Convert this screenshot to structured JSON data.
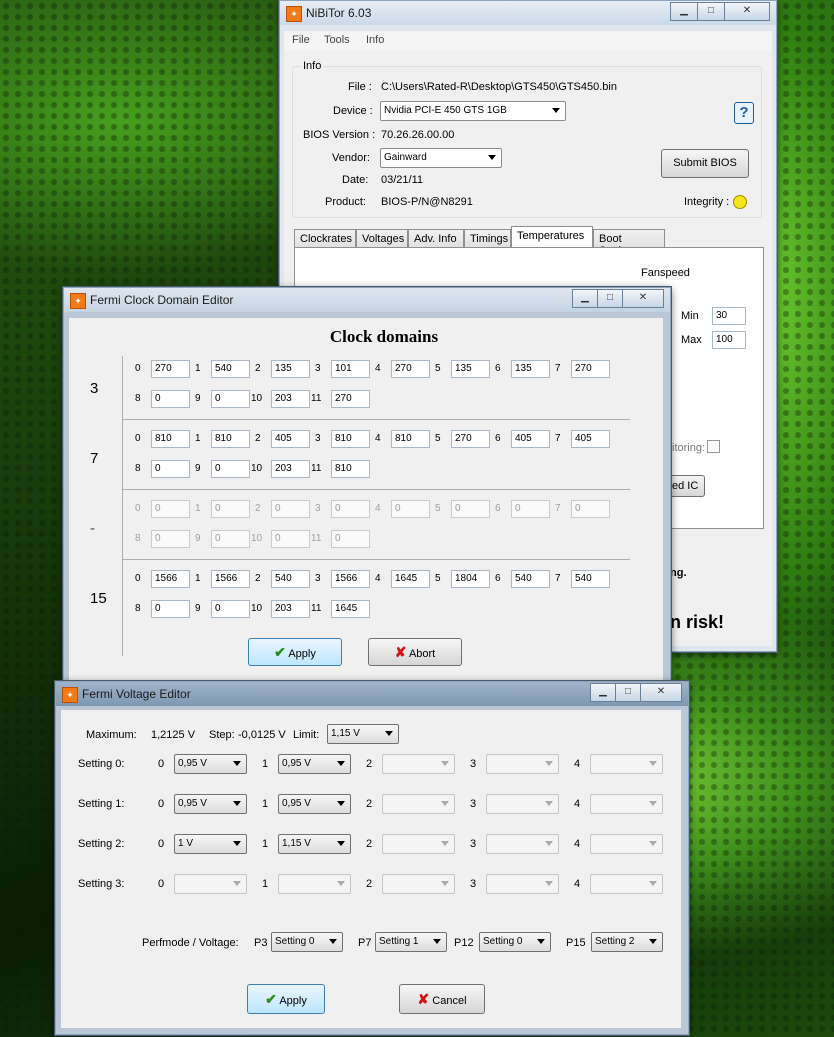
{
  "nibitor": {
    "title": "NiBiTor 6.03",
    "menu": [
      "File",
      "Tools",
      "Info"
    ],
    "info_group": "Info",
    "file_label": "File :",
    "file_value": "C:\\Users\\Rated-R\\Desktop\\GTS450\\GTS450.bin",
    "device_label": "Device :",
    "device_value": "Nvidia PCI-E 450 GTS 1GB",
    "bios_label": "BIOS Version :",
    "bios_value": "70.26.26.00.00",
    "vendor_label": "Vendor:",
    "vendor_value": "Gainward",
    "date_label": "Date:",
    "date_value": "03/21/11",
    "product_label": "Product:",
    "product_value": "BIOS-P/N@N8291",
    "help_symbol": "?",
    "submit_label": "Submit BIOS",
    "integrity_label": "Integrity :",
    "integrity_color": "#f5e51a",
    "tabs": [
      "Clockrates",
      "Voltages",
      "Adv. Info",
      "Timings",
      "Temperatures",
      "Boot Settings"
    ],
    "fanspeed_label": "Fanspeed",
    "min_label": "Min",
    "min_value": "30",
    "max_label": "Max",
    "max_value": "100",
    "monitoring_fragment": "itoring:",
    "ic_fragment": "ed IC",
    "warn1": "ng.",
    "warn2": "n risk!"
  },
  "clock_editor": {
    "title": "Fermi Clock Domain Editor",
    "heading": "Clock domains",
    "groups": [
      {
        "label": "3",
        "disabled": false,
        "values": [
          "270",
          "540",
          "135",
          "101",
          "270",
          "135",
          "135",
          "270",
          "0",
          "0",
          "203",
          "270"
        ]
      },
      {
        "label": "7",
        "disabled": false,
        "values": [
          "810",
          "810",
          "405",
          "810",
          "810",
          "270",
          "405",
          "405",
          "0",
          "0",
          "203",
          "810"
        ]
      },
      {
        "label": "-",
        "disabled": true,
        "values": [
          "0",
          "0",
          "0",
          "0",
          "0",
          "0",
          "0",
          "0",
          "0",
          "0",
          "0",
          "0"
        ]
      },
      {
        "label": "15",
        "disabled": false,
        "values": [
          "1566",
          "1566",
          "540",
          "1566",
          "1645",
          "1804",
          "540",
          "540",
          "0",
          "0",
          "203",
          "1645"
        ]
      }
    ],
    "indices": [
      "0",
      "1",
      "2",
      "3",
      "4",
      "5",
      "6",
      "7",
      "8",
      "9",
      "10",
      "11"
    ],
    "apply_label": "Apply",
    "abort_label": "Abort"
  },
  "voltage_editor": {
    "title": "Fermi Voltage Editor",
    "maximum_label": "Maximum:",
    "maximum_value": "1,2125 V",
    "step_label": "Step:",
    "step_value": "-0,0125 V",
    "limit_label": "Limit:",
    "limit_value": "1,15 V",
    "indices": [
      "0",
      "1",
      "2",
      "3",
      "4"
    ],
    "settings": [
      {
        "label": "Setting 0:",
        "values": [
          "0,95 V",
          "0,95 V",
          "",
          "",
          ""
        ]
      },
      {
        "label": "Setting 1:",
        "values": [
          "0,95 V",
          "0,95 V",
          "",
          "",
          ""
        ]
      },
      {
        "label": "Setting 2:",
        "values": [
          "1 V",
          "1,15 V",
          "",
          "",
          ""
        ]
      },
      {
        "label": "Setting 3:",
        "values": [
          "",
          "",
          "",
          "",
          ""
        ]
      }
    ],
    "perfmode_label": "Perfmode / Voltage:",
    "perfmodes": [
      {
        "label": "P3",
        "value": "Setting 0"
      },
      {
        "label": "P7",
        "value": "Setting 1"
      },
      {
        "label": "P12",
        "value": "Setting 0"
      },
      {
        "label": "P15",
        "value": "Setting 2"
      }
    ],
    "apply_label": "Apply",
    "cancel_label": "Cancel"
  }
}
